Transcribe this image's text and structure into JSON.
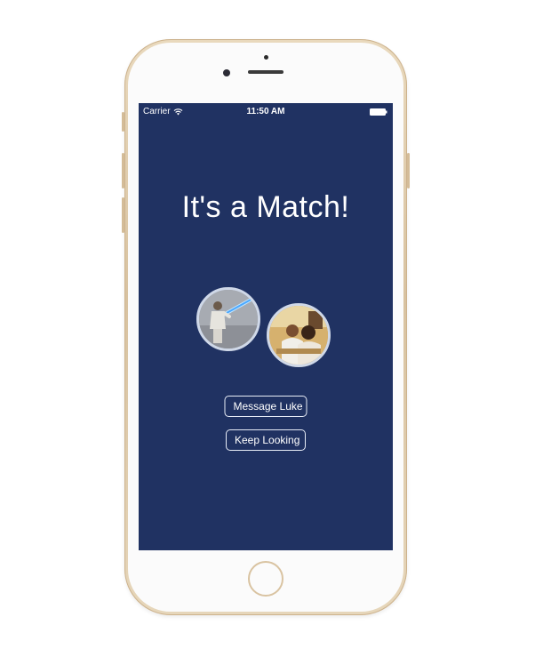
{
  "status_bar": {
    "carrier": "Carrier",
    "time": "11:50 AM",
    "wifi_icon": "wifi-icon",
    "battery_icon": "battery-icon"
  },
  "match_screen": {
    "title": "It's a Match!",
    "avatars": [
      {
        "name": "matched-user-avatar",
        "icon": "lightsaber-photo"
      },
      {
        "name": "current-user-avatar",
        "icon": "people-photo"
      }
    ],
    "message_button_label": "Message Luke",
    "keep_looking_button_label": "Keep Looking"
  },
  "colors": {
    "screen_background": "#203262",
    "text": "#ffffff",
    "button_border": "#e8edf7",
    "phone_gold": "#e2cfae"
  }
}
